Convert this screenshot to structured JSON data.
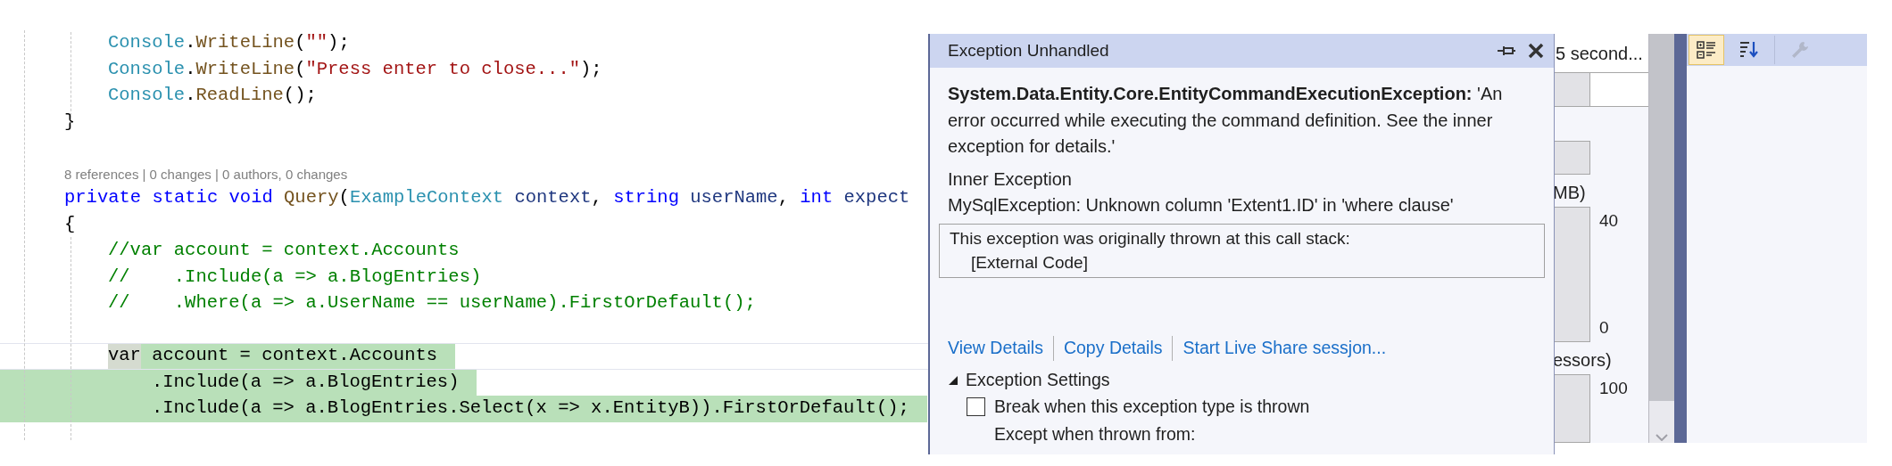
{
  "editor": {
    "lines": [
      {
        "kind": "code",
        "indented": true,
        "continued": false,
        "highlighted": false,
        "tokens": [
          {
            "text": "Console",
            "kind": "type"
          },
          {
            "text": ".",
            "kind": "plain"
          },
          {
            "text": "WriteLine",
            "kind": "method"
          },
          {
            "text": "(",
            "kind": "plain"
          },
          {
            "text": "\"\"",
            "kind": "string"
          },
          {
            "text": ");",
            "kind": "plain"
          }
        ]
      },
      {
        "kind": "code",
        "indented": true,
        "continued": false,
        "highlighted": false,
        "tokens": [
          {
            "text": "Console",
            "kind": "type"
          },
          {
            "text": ".",
            "kind": "plain"
          },
          {
            "text": "WriteLine",
            "kind": "method"
          },
          {
            "text": "(",
            "kind": "plain"
          },
          {
            "text": "\"Press enter to close...\"",
            "kind": "string"
          },
          {
            "text": ");",
            "kind": "plain"
          }
        ]
      },
      {
        "kind": "code",
        "indented": true,
        "continued": false,
        "highlighted": false,
        "tokens": [
          {
            "text": "Console",
            "kind": "type"
          },
          {
            "text": ".",
            "kind": "plain"
          },
          {
            "text": "ReadLine",
            "kind": "method"
          },
          {
            "text": "();",
            "kind": "plain"
          }
        ]
      },
      {
        "kind": "code",
        "indented": false,
        "continued": false,
        "highlighted": false,
        "tokens": [
          {
            "text": "}",
            "kind": "plain"
          }
        ]
      },
      {
        "kind": "codelens",
        "text": "8 references | 0 changes | 0 authors, 0 changes"
      },
      {
        "kind": "code",
        "indented": false,
        "continued": false,
        "highlighted": false,
        "tokens": [
          {
            "text": "private static void ",
            "kind": "keyword"
          },
          {
            "text": "Query",
            "kind": "method"
          },
          {
            "text": "(",
            "kind": "plain"
          },
          {
            "text": "ExampleContext",
            "kind": "type"
          },
          {
            "text": " context",
            "kind": "param"
          },
          {
            "text": ", ",
            "kind": "plain"
          },
          {
            "text": "string",
            "kind": "keyword"
          },
          {
            "text": " userName",
            "kind": "param"
          },
          {
            "text": ", ",
            "kind": "plain"
          },
          {
            "text": "int",
            "kind": "keyword"
          },
          {
            "text": " expect",
            "kind": "param"
          }
        ]
      },
      {
        "kind": "code",
        "indented": false,
        "continued": false,
        "highlighted": false,
        "tokens": [
          {
            "text": "{",
            "kind": "plain"
          }
        ]
      },
      {
        "kind": "code",
        "indented": true,
        "continued": false,
        "highlighted": false,
        "tokens": [
          {
            "text": "//var account = context.Accounts",
            "kind": "comment"
          }
        ]
      },
      {
        "kind": "code",
        "indented": true,
        "continued": false,
        "highlighted": false,
        "tokens": [
          {
            "text": "//    .Include(a => a.BlogEntries)",
            "kind": "comment"
          }
        ]
      },
      {
        "kind": "code",
        "indented": true,
        "continued": false,
        "highlighted": false,
        "tokens": [
          {
            "text": "//    .Where(a => a.UserName == userName).FirstOrDefault();",
            "kind": "comment"
          }
        ]
      },
      {
        "kind": "blank"
      },
      {
        "kind": "code",
        "indented": true,
        "continued": false,
        "highlighted": true,
        "tokens": [
          {
            "text": "var",
            "kind": "plain",
            "marked": true
          },
          {
            "text": " account = context.Accounts",
            "kind": "plain",
            "marked": false
          }
        ]
      },
      {
        "kind": "code",
        "indented": true,
        "continued": true,
        "highlighted": true,
        "tokens": [
          {
            "text": ".Include(a => a.BlogEntries)",
            "kind": "plain"
          }
        ]
      },
      {
        "kind": "code",
        "indented": true,
        "continued": true,
        "highlighted": true,
        "tokens": [
          {
            "text": ".Include(a => a.BlogEntries.Select(x => x.EntityB)).FirstOrDefault();",
            "kind": "plain"
          }
        ]
      }
    ]
  },
  "diagnostics": {
    "header": "5 second...",
    "charts": [
      {
        "title": "MB)",
        "max_label": "40",
        "min_label": "0"
      },
      {
        "title": "essors)",
        "max_label": "100"
      }
    ]
  },
  "exception": {
    "title": "Exception Unhandled",
    "message": "**System.Data.Entity.Core.EntityCommandExecutionException:** 'An error occurred while executing the command definition. See the inner exception for details.'",
    "inner_title": "Inner Exception",
    "inner_message": "MySqlException: Unknown column 'Extent1.ID' in 'where clause'",
    "stack_header": "This exception was originally thrown at this call stack:",
    "stack_frames": [
      "[External Code]"
    ],
    "links": [
      "View Details",
      "Copy Details",
      "Start Live Share sessjon..."
    ],
    "settings": {
      "title": "Exception Settings",
      "expanded": true,
      "options": [
        {
          "label": "Break when this exception type is thrown",
          "checked": false
        }
      ],
      "except_label": "Except when thrown from:"
    }
  },
  "properties": {
    "toolbar": [
      {
        "kind": "categorized",
        "selected": true,
        "disabled": false
      },
      {
        "kind": "alphabetical",
        "selected": false,
        "disabled": false
      },
      {
        "kind": "property-pages",
        "selected": false,
        "disabled": true
      }
    ]
  }
}
